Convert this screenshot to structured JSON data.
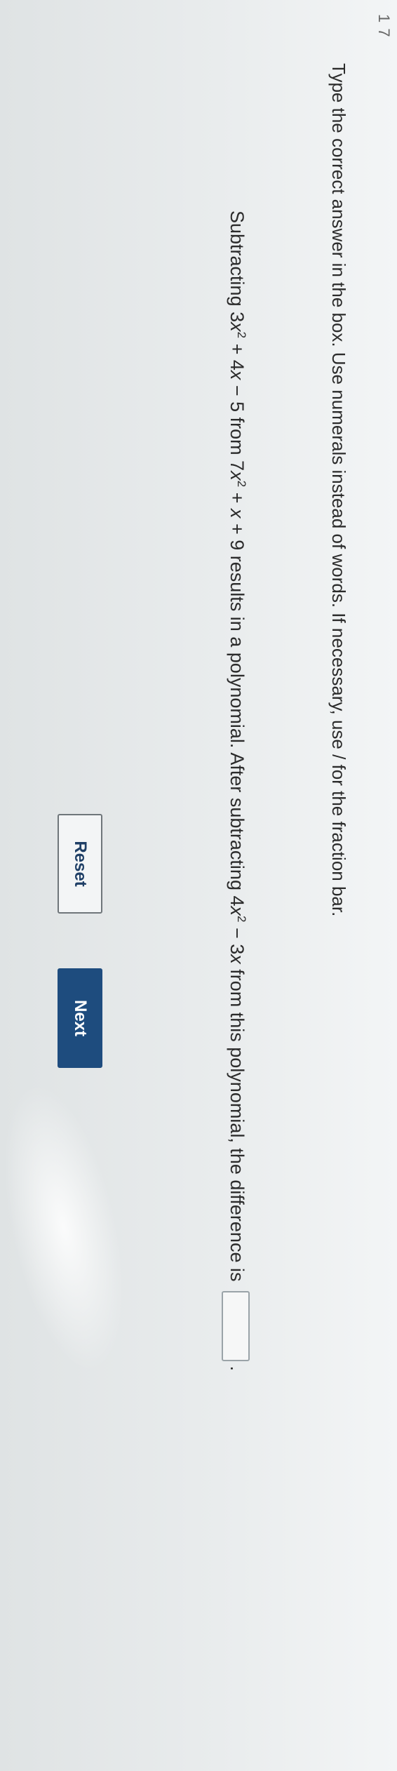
{
  "page": {
    "corner_mark": "1 7",
    "instruction": "Type the correct answer in the box. Use numerals instead of words. If necessary, use / for the fraction bar."
  },
  "question": {
    "p1": "Subtracting 3",
    "t1": "x",
    "s1": "2",
    "p2": " + 4",
    "t2": "x",
    "p3": " − 5 from 7",
    "t3": "x",
    "s2": "2",
    "p4": " + ",
    "t4": "x",
    "p5": " + 9 results in a polynomial. After subtracting 4",
    "t5": "x",
    "s3": "2",
    "p6": " − 3",
    "t6": "x",
    "p7": " from this polynomial, the difference is",
    "answer_value": "",
    "end": "."
  },
  "buttons": {
    "reset_label": "Reset",
    "next_label": "Next"
  },
  "colors": {
    "next_button_bg": "#1e4c7e",
    "reset_button_text": "#1f3f66"
  }
}
